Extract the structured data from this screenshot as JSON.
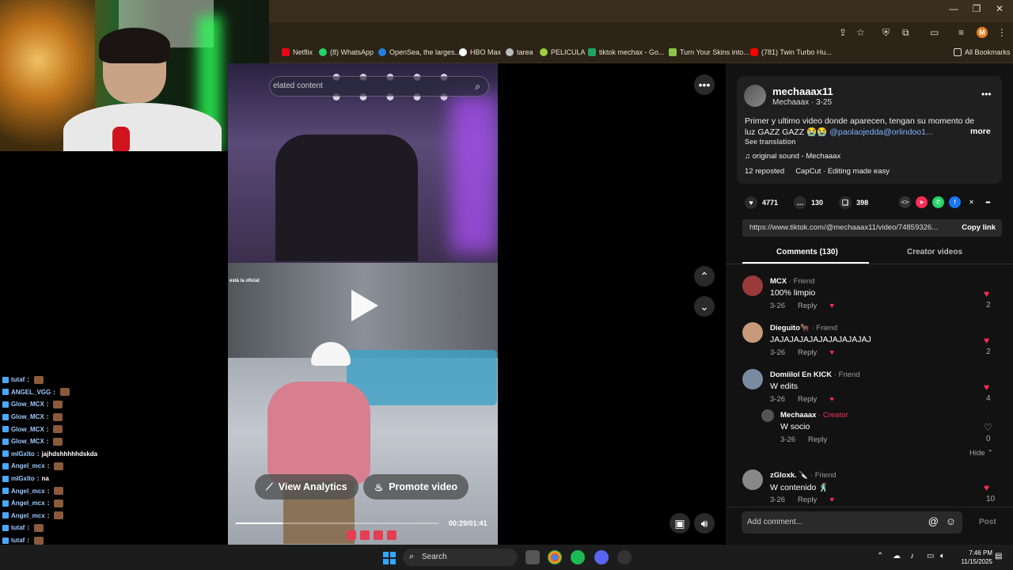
{
  "bookmarks": [
    {
      "label": "Netflix",
      "color": "#e50914"
    },
    {
      "label": "(8) WhatsApp",
      "color": "#25d366"
    },
    {
      "label": "OpenSea, the larges...",
      "color": "#2081e2"
    },
    {
      "label": "HBO Max",
      "color": "#ffffff"
    },
    {
      "label": "tarea",
      "color": "#bbbbbb"
    },
    {
      "label": "PELICULA",
      "color": "#9bd23c"
    },
    {
      "label": "tiktok mechax - Go...",
      "color": "#1fa463"
    },
    {
      "label": "Turn Your Skins into...",
      "color": "#8bc34a"
    },
    {
      "label": "(781) Twin Turbo Hu...",
      "color": "#ff0000"
    }
  ],
  "all_bookmarks": "All Bookmarks",
  "profile_initial": "M",
  "chat": [
    {
      "user": "tutaf",
      "msg": ""
    },
    {
      "user": "ANGEL_VGG",
      "msg": ""
    },
    {
      "user": "Glow_MCX",
      "msg": ""
    },
    {
      "user": "Glow_MCX",
      "msg": ""
    },
    {
      "user": "Glow_MCX",
      "msg": ""
    },
    {
      "user": "Glow_MCX",
      "msg": ""
    },
    {
      "user": "mIGxlto",
      "msg": "jajhdshhhhhdskda"
    },
    {
      "user": "Angel_mcx",
      "msg": ""
    },
    {
      "user": "mIGxlto",
      "msg": "na"
    },
    {
      "user": "Angel_mcx",
      "msg": ""
    },
    {
      "user": "Angel_mcx",
      "msg": ""
    },
    {
      "user": "Angel_mcx",
      "msg": ""
    },
    {
      "user": "tutaf",
      "msg": ""
    },
    {
      "user": "tutaf",
      "msg": ""
    }
  ],
  "video": {
    "search_text": "elated content",
    "overlay_text": "está la oficial",
    "view_analytics": "View Analytics",
    "promote_video": "Promote video",
    "timecode": "00:29/01:41",
    "progress": 0.23
  },
  "post": {
    "username": "mechaaax11",
    "subname": "Mechaaax · 3-25",
    "desc_prefix": "Primer y ultimo video donde aparecen, tengan su momento de luz GAZZ GAZZ 😭😭 ",
    "desc_mentions": "@paolaojedda@orlindoo1...",
    "more": "more",
    "see_translation": "See translation",
    "sound": "original sound - Mechaaax",
    "reposted": "12 reposted",
    "capcut": "CapCut · Editing made easy",
    "likes": "4771",
    "comments": "130",
    "saves": "398",
    "url": "https://www.tiktok.com/@mechaaax11/video/74859326...",
    "copy_link": "Copy link"
  },
  "tabs": {
    "comments": "Comments (130)",
    "creator_videos": "Creator videos"
  },
  "comments": [
    {
      "name": "MCX",
      "tag": "· Friend",
      "text": "100% limpio",
      "date": "3-26",
      "reply": "Reply",
      "likes": "2"
    },
    {
      "name": "Dieguito🐂",
      "tag": "· Friend",
      "text": "JAJAJAJAJAJAJAJAJAJAJ",
      "date": "3-26",
      "reply": "Reply",
      "likes": "2"
    },
    {
      "name": "Domiilol En KICK",
      "tag": "· Friend",
      "text": "W edits",
      "date": "3-26",
      "reply": "Reply",
      "likes": "4"
    },
    {
      "name": "Mechaaax",
      "tag": "· Creator",
      "text": "W socio",
      "date": "3-26",
      "reply": "Reply",
      "likes": "0"
    },
    {
      "name": "zGloxk. 🔪",
      "tag": "· Friend",
      "text": "W contenido 🕺",
      "date": "3-26",
      "reply": "Reply",
      "likes": "10"
    }
  ],
  "hide_label": "Hide ⌃",
  "comment_placeholder": "Add comment...",
  "post_label": "Post",
  "taskbar": {
    "search": "Search",
    "time": "7:46 PM",
    "date": "11/15/2025"
  }
}
